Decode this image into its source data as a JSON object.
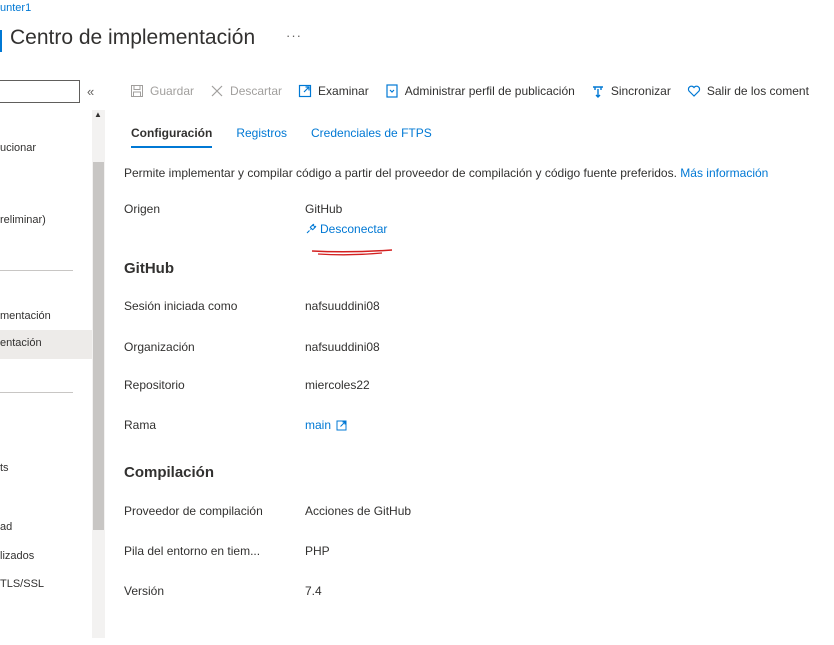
{
  "breadcrumb": "unter1",
  "page_title": "Centro de implementación",
  "more_label": "···",
  "collapse_label": "«",
  "sidebar": {
    "items": [
      {
        "label": "ucionar"
      },
      {
        "label": "reliminar)"
      },
      {
        "label": "mentación"
      },
      {
        "label": "entación"
      },
      {
        "label": "ts"
      },
      {
        "label": "ad"
      },
      {
        "label": "lizados"
      },
      {
        "label": "TLS/SSL"
      }
    ]
  },
  "toolbar": {
    "guardar": "Guardar",
    "descartar": "Descartar",
    "examinar": "Examinar",
    "administrar": "Administrar perfil de publicación",
    "sincronizar": "Sincronizar",
    "salir": "Salir de los coment"
  },
  "tabs": [
    {
      "label": "Configuración",
      "active": true
    },
    {
      "label": "Registros",
      "active": false
    },
    {
      "label": "Credenciales de FTPS",
      "active": false
    }
  ],
  "description": {
    "text": "Permite implementar y compilar código a partir del proveedor de compilación y código fuente preferidos.",
    "link": "Más información"
  },
  "origen": {
    "label": "Origen",
    "value": "GitHub",
    "disconnect": "Desconectar"
  },
  "github": {
    "heading": "GitHub",
    "session_label": "Sesión iniciada como",
    "session_value": "nafsuuddini08",
    "org_label": "Organización",
    "org_value": "nafsuuddini08",
    "repo_label": "Repositorio",
    "repo_value": "miercoles22",
    "branch_label": "Rama",
    "branch_value": "main"
  },
  "build": {
    "heading": "Compilación",
    "provider_label": "Proveedor de compilación",
    "provider_value": "Acciones de GitHub",
    "stack_label": "Pila del entorno en tiem...",
    "stack_value": "PHP",
    "version_label": "Versión",
    "version_value": "7.4"
  },
  "colors": {
    "accent": "#0078d4",
    "annotation": "#d32020"
  }
}
